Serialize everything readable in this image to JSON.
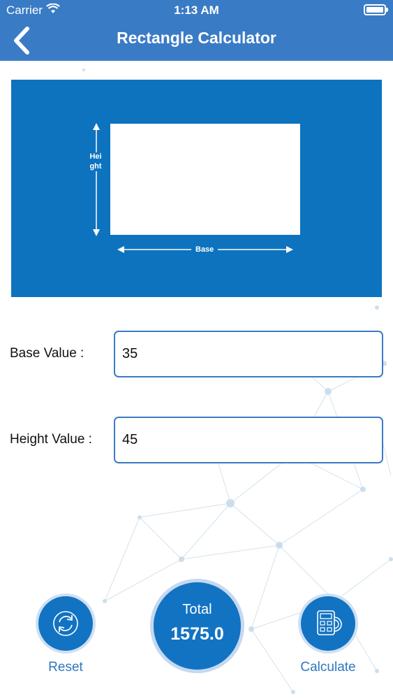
{
  "status_bar": {
    "carrier": "Carrier",
    "time": "1:13 AM"
  },
  "header": {
    "title": "Rectangle Calculator",
    "back_icon": "chevron-left-icon"
  },
  "diagram": {
    "height_label": "Height",
    "base_label": "Base"
  },
  "form": {
    "base_label": "Base Value :",
    "base_value": "35",
    "height_label": "Height Value :",
    "height_value": "45"
  },
  "result": {
    "total_label": "Total",
    "total_value": "1575.0"
  },
  "actions": {
    "reset_label": "Reset",
    "reset_icon": "refresh-icon",
    "calculate_label": "Calculate",
    "calculate_icon": "calculator-icon"
  },
  "colors": {
    "header": "#3a7bc5",
    "diagram": "#0d73bf",
    "button": "#1273c3",
    "caption": "#2f77c0"
  }
}
